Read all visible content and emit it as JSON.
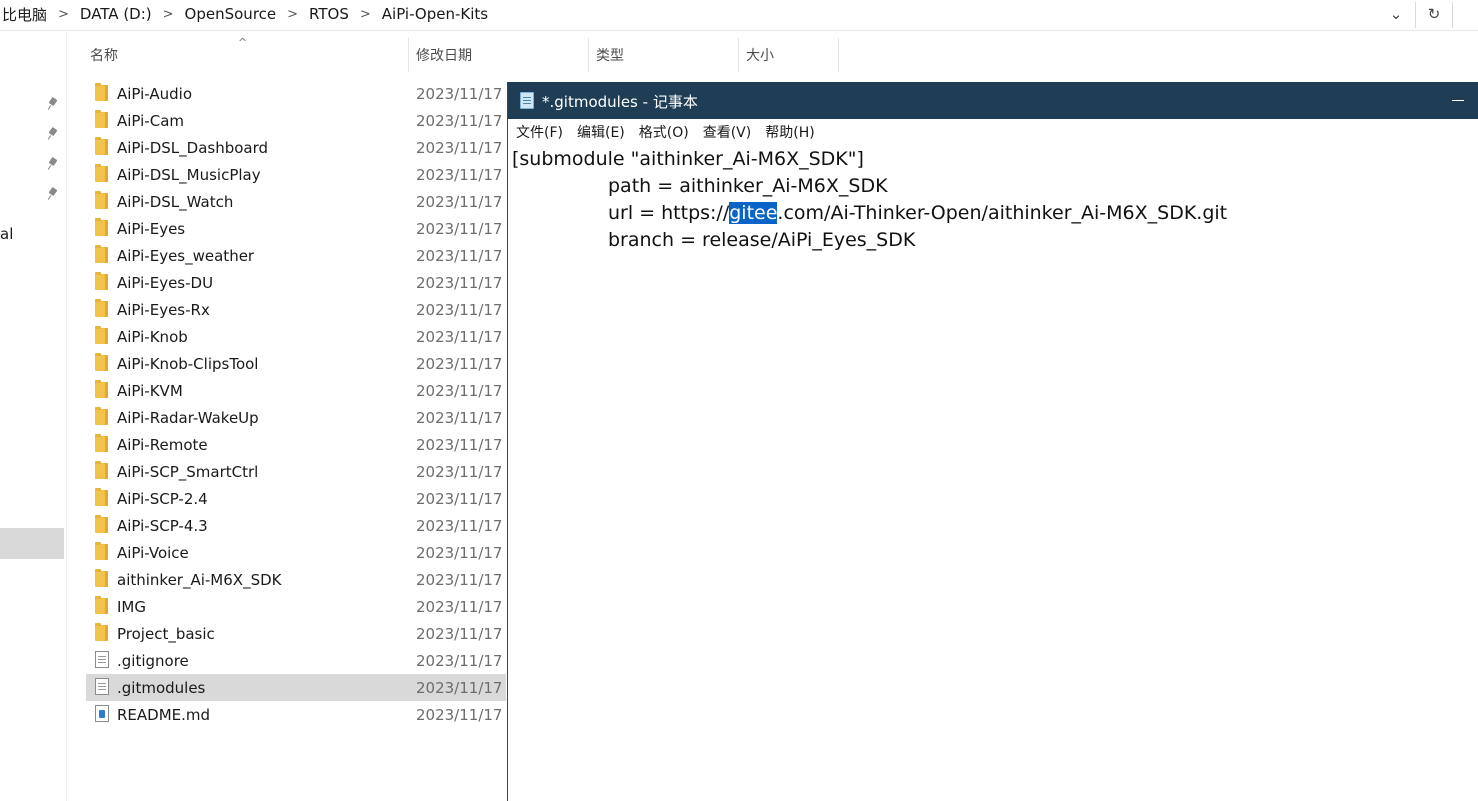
{
  "address_bar": {
    "crumbs": [
      "比电脑",
      "DATA (D:)",
      "OpenSource",
      "RTOS",
      "AiPi-Open-Kits"
    ],
    "separator": ">",
    "dropdown_icon": "chevron-down-icon",
    "refresh_icon": "refresh-icon"
  },
  "nav_pane": {
    "partial_label": "al"
  },
  "columns": {
    "name": "名称",
    "date": "修改日期",
    "type": "类型",
    "size": "大小"
  },
  "files": [
    {
      "name": "AiPi-Audio",
      "date": "2023/11/17",
      "kind": "folder"
    },
    {
      "name": "AiPi-Cam",
      "date": "2023/11/17",
      "kind": "folder"
    },
    {
      "name": "AiPi-DSL_Dashboard",
      "date": "2023/11/17",
      "kind": "folder"
    },
    {
      "name": "AiPi-DSL_MusicPlay",
      "date": "2023/11/17",
      "kind": "folder"
    },
    {
      "name": "AiPi-DSL_Watch",
      "date": "2023/11/17",
      "kind": "folder"
    },
    {
      "name": "AiPi-Eyes",
      "date": "2023/11/17",
      "kind": "folder"
    },
    {
      "name": "AiPi-Eyes_weather",
      "date": "2023/11/17",
      "kind": "folder"
    },
    {
      "name": "AiPi-Eyes-DU",
      "date": "2023/11/17",
      "kind": "folder"
    },
    {
      "name": "AiPi-Eyes-Rx",
      "date": "2023/11/17",
      "kind": "folder"
    },
    {
      "name": "AiPi-Knob",
      "date": "2023/11/17",
      "kind": "folder"
    },
    {
      "name": "AiPi-Knob-ClipsTool",
      "date": "2023/11/17",
      "kind": "folder"
    },
    {
      "name": "AiPi-KVM",
      "date": "2023/11/17",
      "kind": "folder"
    },
    {
      "name": "AiPi-Radar-WakeUp",
      "date": "2023/11/17",
      "kind": "folder"
    },
    {
      "name": "AiPi-Remote",
      "date": "2023/11/17",
      "kind": "folder"
    },
    {
      "name": "AiPi-SCP_SmartCtrl",
      "date": "2023/11/17",
      "kind": "folder"
    },
    {
      "name": "AiPi-SCP-2.4",
      "date": "2023/11/17",
      "kind": "folder"
    },
    {
      "name": "AiPi-SCP-4.3",
      "date": "2023/11/17",
      "kind": "folder"
    },
    {
      "name": "AiPi-Voice",
      "date": "2023/11/17",
      "kind": "folder"
    },
    {
      "name": "aithinker_Ai-M6X_SDK",
      "date": "2023/11/17",
      "kind": "folder"
    },
    {
      "name": "IMG",
      "date": "2023/11/17",
      "kind": "folder"
    },
    {
      "name": "Project_basic",
      "date": "2023/11/17",
      "kind": "folder"
    },
    {
      "name": ".gitignore",
      "date": "2023/11/17",
      "kind": "file"
    },
    {
      "name": ".gitmodules",
      "date": "2023/11/17",
      "kind": "file",
      "selected": true
    },
    {
      "name": "README.md",
      "date": "2023/11/17",
      "kind": "md"
    }
  ],
  "notepad": {
    "title": "*.gitmodules - 记事本",
    "menu": [
      "文件(F)",
      "编辑(E)",
      "格式(O)",
      "查看(V)",
      "帮助(H)"
    ],
    "lines": [
      {
        "indent": false,
        "text": "[submodule \"aithinker_Ai-M6X_SDK\"]"
      },
      {
        "indent": true,
        "text": "path = aithinker_Ai-M6X_SDK"
      },
      {
        "indent": true,
        "pre": "url = https://",
        "highlight": "gitee",
        "post": ".com/Ai-Thinker-Open/aithinker_Ai-M6X_SDK.git"
      },
      {
        "indent": true,
        "text": "branch = release/AiPi_Eyes_SDK"
      }
    ],
    "selection_color": "#0a64c8",
    "title_bar_color": "#1f3e55"
  }
}
